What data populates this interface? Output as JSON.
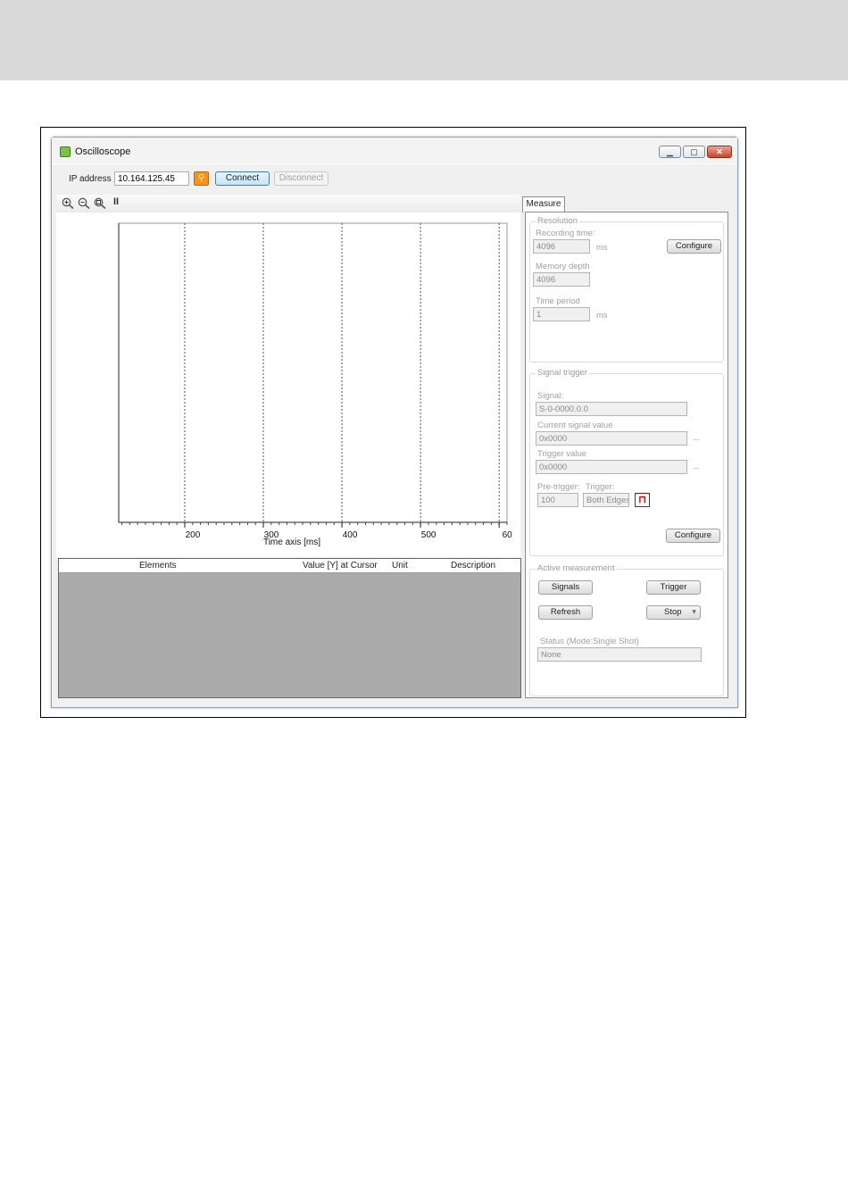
{
  "window": {
    "title": "Oscilloscope",
    "minimize": "▁",
    "maximize": "▢",
    "close": "✕"
  },
  "connection": {
    "ip_label": "IP address",
    "ip_value": "10.164.125.45",
    "connect": "Connect",
    "disconnect": "Disconnect"
  },
  "toolbar": {
    "tools": [
      "zoom-in-icon",
      "zoom-out-icon",
      "zoom-reset-icon",
      "pause-icon"
    ],
    "pause": "II"
  },
  "chart_data": {
    "type": "line",
    "xlabel": "Time axis [ms]",
    "ylabel": "",
    "x_ticks": [
      "200",
      "300",
      "400",
      "500",
      "60"
    ],
    "x_ticks_values": [
      200,
      300,
      400,
      500,
      600
    ],
    "xlim": [
      116,
      610
    ],
    "series": []
  },
  "grid": {
    "columns": [
      "Elements",
      "Value [Y] at Cursor",
      "Unit",
      "Description"
    ]
  },
  "tabs": {
    "measure": "Measure"
  },
  "resolution": {
    "title": "Resolution",
    "recording_label": "Recording time:",
    "recording_value": "4096",
    "recording_unit": "ms",
    "configure": "Configure",
    "memory_label": "Memory depth",
    "memory_value": "4096",
    "period_label": "Time period",
    "period_value": "1",
    "period_unit": "ms"
  },
  "signal_trigger": {
    "title": "Signal trigger",
    "signal_label": "Signal:",
    "signal_value": "S-0-0000.0.0",
    "current_label": "Current signal value",
    "current_value": "0x0000",
    "current_unit": "--",
    "trigger_value_label": "Trigger value",
    "trigger_value": "0x0000",
    "trigger_unit": "--",
    "pretrigger_label": "Pre-trigger:",
    "pretrigger_value": "100",
    "trigger_label": "Trigger:",
    "trigger_mode": "Both Edges",
    "configure": "Configure"
  },
  "active_measurement": {
    "title": "Active measurement",
    "signals": "Signals",
    "trigger": "Trigger",
    "refresh": "Refresh",
    "stop": "Stop",
    "stop_arrow": "▾",
    "status_label": "Status (Mode:Single Shot)",
    "status_value": "None"
  }
}
